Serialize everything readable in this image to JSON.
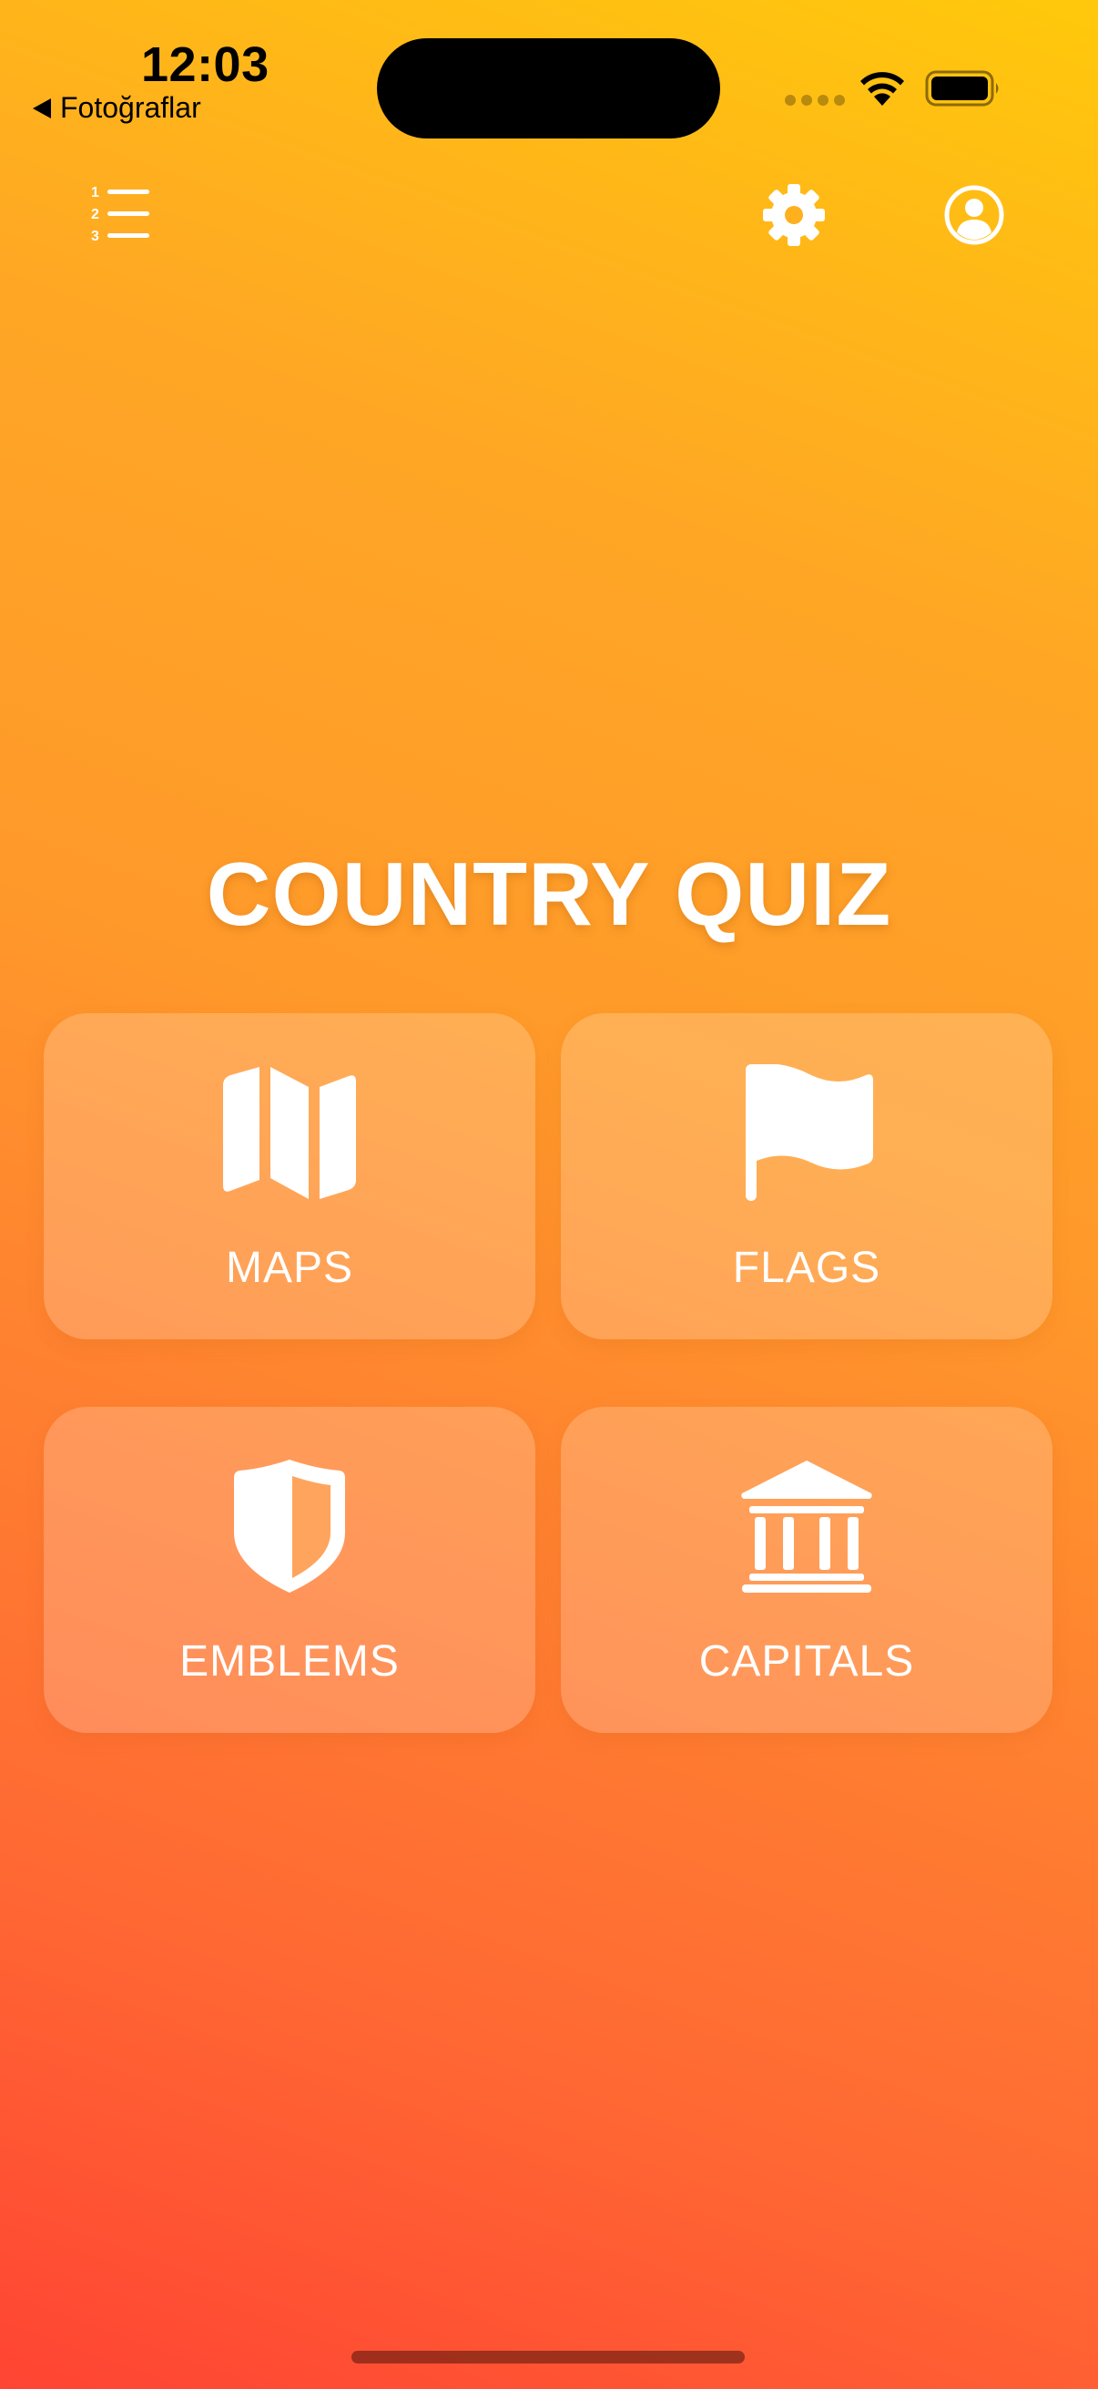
{
  "status_bar": {
    "time": "12:03",
    "back_label": "Fotoğraflar"
  },
  "toolbar": {
    "leaderboard_icon": "numbered-list-icon",
    "settings_icon": "gear-icon",
    "profile_icon": "person-circle-icon"
  },
  "title": "COUNTRY QUIZ",
  "categories": [
    {
      "label": "MAPS",
      "icon": "map-icon"
    },
    {
      "label": "FLAGS",
      "icon": "flag-icon"
    },
    {
      "label": "EMBLEMS",
      "icon": "shield-icon"
    },
    {
      "label": "CAPITALS",
      "icon": "building-columns-icon"
    }
  ],
  "colors": {
    "gradient_top": "#FFC90B",
    "gradient_middle": "#FF8230",
    "gradient_bottom": "#FF4433",
    "text": "#FFFFFF"
  }
}
